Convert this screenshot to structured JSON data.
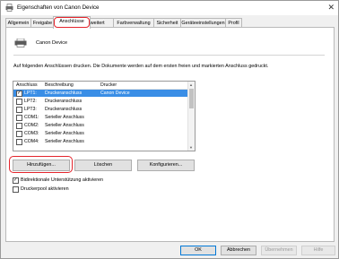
{
  "window": {
    "title": "Eigenschaften von Canon Device",
    "close_glyph": "✕"
  },
  "tabs": [
    {
      "label": "Allgemein"
    },
    {
      "label": "Freigabe"
    },
    {
      "label": "Anschlüsse"
    },
    {
      "label": "Erweitert"
    },
    {
      "label": "Farbverwaltung"
    },
    {
      "label": "Sicherheit"
    },
    {
      "label": "Geräteeinstellungen"
    },
    {
      "label": "Profil"
    }
  ],
  "device": {
    "name": "Canon Device",
    "icon": "printer-icon"
  },
  "instructions": "Auf folgenden Anschlüssen drucken. Die Dokumente werden auf dem ersten freien und markierten Anschluss gedruckt.",
  "port_table": {
    "columns": [
      "Anschluss",
      "Beschreibung",
      "Drucker"
    ],
    "rows": [
      {
        "port": "LPT1:",
        "desc": "Druckeranschluss",
        "printer": "Canon Device",
        "checked": true,
        "selected": true
      },
      {
        "port": "LPT2:",
        "desc": "Druckeranschluss",
        "printer": "",
        "checked": false,
        "selected": false
      },
      {
        "port": "LPT3:",
        "desc": "Druckeranschluss",
        "printer": "",
        "checked": false,
        "selected": false
      },
      {
        "port": "COM1:",
        "desc": "Serieller Anschluss",
        "printer": "",
        "checked": false,
        "selected": false
      },
      {
        "port": "COM2:",
        "desc": "Serieller Anschluss",
        "printer": "",
        "checked": false,
        "selected": false
      },
      {
        "port": "COM3:",
        "desc": "Serieller Anschluss",
        "printer": "",
        "checked": false,
        "selected": false
      },
      {
        "port": "COM4:",
        "desc": "Serieller Anschluss",
        "printer": "",
        "checked": false,
        "selected": false
      }
    ]
  },
  "port_buttons": {
    "add": "Hinzufügen...",
    "delete": "Löschen",
    "configure": "Konfigurieren..."
  },
  "options": {
    "bidi": {
      "label": "Bidirektionale Unterstützung aktivieren",
      "checked": true
    },
    "pool": {
      "label": "Druckerpool aktivieren",
      "checked": false
    }
  },
  "dialog_buttons": {
    "ok": "OK",
    "cancel": "Abbrechen",
    "apply": "Übernehmen",
    "help": "Hilfe"
  },
  "colors": {
    "highlight": "#e4252d",
    "selection": "#3a8ee6"
  }
}
